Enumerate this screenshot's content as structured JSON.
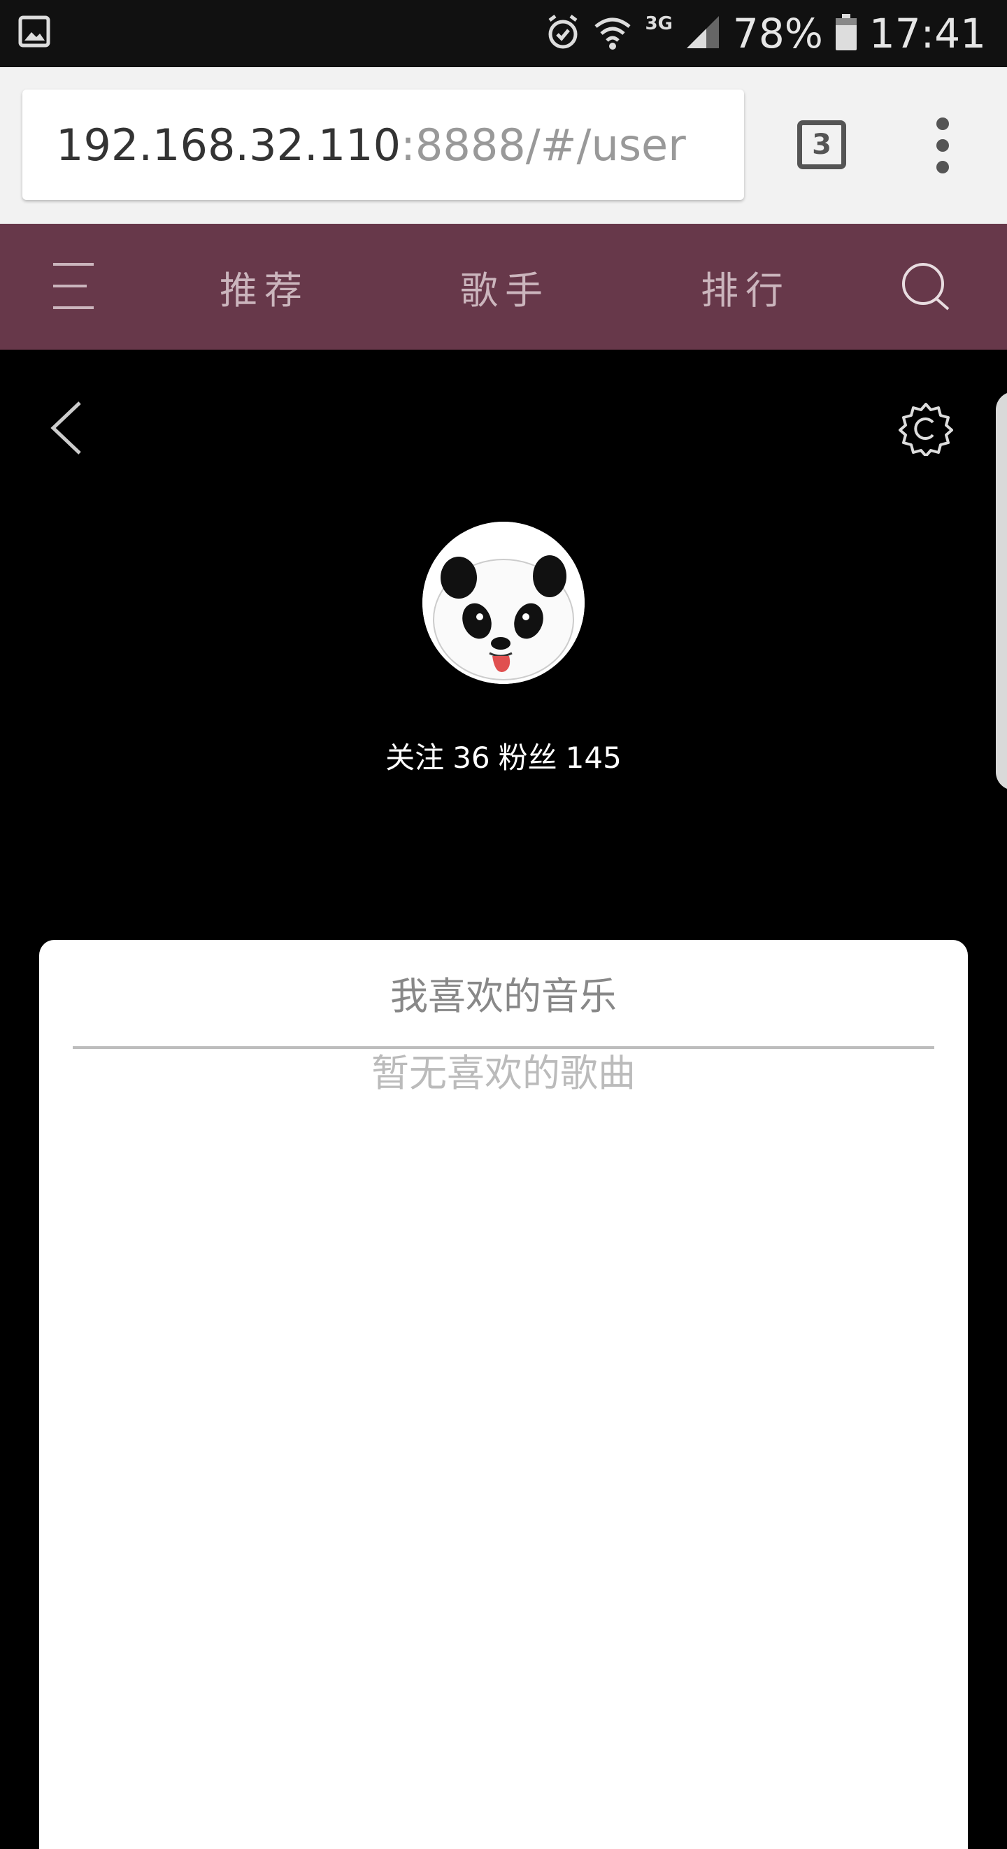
{
  "status_bar": {
    "network_type": "3G",
    "battery": "78%",
    "time": "17:41",
    "icons": [
      "gallery-icon",
      "alarm-icon",
      "wifi-icon",
      "signal-icon",
      "battery-icon"
    ]
  },
  "browser": {
    "url_host": "192.168.32.110",
    "url_path": ":8888/#/user",
    "tab_count": "3"
  },
  "app_nav": {
    "background": "#67384a",
    "items": [
      {
        "label": "推荐"
      },
      {
        "label": "歌手"
      },
      {
        "label": "排行"
      }
    ]
  },
  "user": {
    "avatar_icon": "panda-avatar",
    "follow_label": "关注",
    "follow_count": "36",
    "fans_label": "粉丝",
    "fans_count": "145"
  },
  "liked": {
    "title": "我喜欢的音乐",
    "empty_text": "暂无喜欢的歌曲"
  }
}
